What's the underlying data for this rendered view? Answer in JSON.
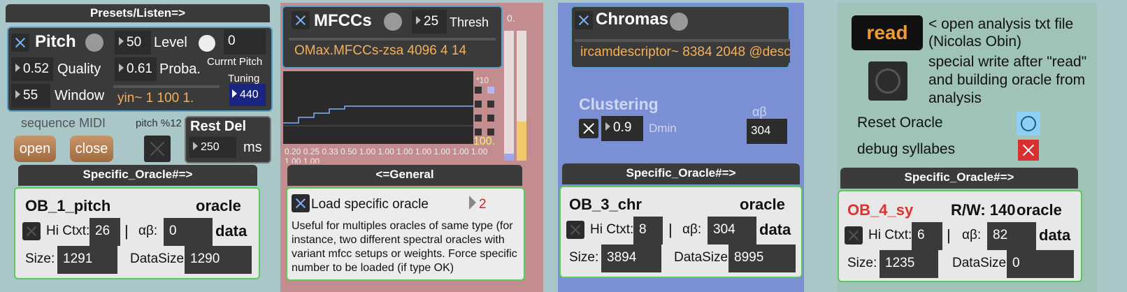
{
  "pitch_panel": {
    "header": "Presets/Listen=>",
    "title": "Pitch",
    "level_value": "50",
    "level_label": "Level",
    "level_number": "0",
    "quality_value": "0.52",
    "quality_label": "Quality",
    "proba_value": "0.61",
    "proba_label": "Proba.",
    "current_pitch_label": "Currnt Pitch",
    "tuning_label": "Tuning",
    "window_value": "55",
    "window_label": "Window",
    "yin_message": "yin~ 1 100 1.",
    "tuning_value": "440",
    "sequence_midi_label": "sequence MIDI",
    "pitch_mod_label": "pitch %12",
    "open_label": "open",
    "close_label": "close",
    "rest_del_label": "Rest Del",
    "rest_del_value": "250",
    "rest_del_unit": "ms",
    "specific_header": "Specific_Oracle#=>",
    "oracle": {
      "name": "OB_1_pitch",
      "oracle_label": "oracle",
      "hi_ctxt_label": "Hi Ctxt:",
      "hi_ctxt_value": "26",
      "ab_label": "αβ:",
      "ab_value": "0",
      "data_label": "data",
      "size_label": "Size:",
      "size_value": "1291",
      "datasize_label": "DataSize",
      "datasize_value": "1290"
    }
  },
  "mfcc_panel": {
    "title": "MFCCs",
    "thresh_value": "25",
    "thresh_label": "Thresh",
    "message": "OMax.MFCCs-zsa 4096 4 14",
    "scale_label_top": "*10",
    "meter_label": "0.",
    "meter_label_100": "100.",
    "axis_labels": "0.20 0.25 0.33 0.50 1.00 1.00 1.00 1.00 1.00 1.00 1.00 1.00 1.00",
    "general_header": "<=General",
    "load_label": "Load specific oracle",
    "load_number": "2",
    "description": "Useful for multiples oracles of same type (for instance, two different spectral oracles with variant mfcc setups or weights. Force specific number to be loaded (if type OK)"
  },
  "chroma_panel": {
    "title": "Chromas",
    "message": "ircamdescriptor~ 8384 2048 @desc",
    "clustering_label": "Clustering",
    "dmin_value": "0.9",
    "dmin_label": "Dmin",
    "ab_label": "αβ",
    "ab_value": "304",
    "specific_header": "Specific_Oracle#=>",
    "oracle": {
      "name": "OB_3_chr",
      "oracle_label": "oracle",
      "hi_ctxt_label": "Hi Ctxt:",
      "hi_ctxt_value": "8",
      "ab_label": "αβ:",
      "ab_value": "304",
      "data_label": "data",
      "size_label": "Size:",
      "size_value": "3894",
      "datasize_label": "DataSize",
      "datasize_value": "8995"
    }
  },
  "analysis_panel": {
    "read_label": "read",
    "read_desc": "< open analysis txt file (Nicolas Obin)",
    "special_desc": "special write after \"read\" and  building oracle from analysis",
    "reset_label": "Reset Oracle",
    "debug_label": "debug syllabes",
    "specific_header": "Specific_Oracle#=>",
    "oracle": {
      "name": "OB_4_sy",
      "rw_label": "R/W: 140",
      "oracle_label": "oracle",
      "hi_ctxt_label": "Hi Ctxt:",
      "hi_ctxt_value": "6",
      "ab_label": "αβ:",
      "ab_value": "82",
      "data_label": "data",
      "size_label": "Size:",
      "size_value": "1235",
      "datasize_label": "DataSize",
      "datasize_value": "0"
    }
  },
  "colors": {
    "pitch_bg": "#a9c6c8",
    "mfcc_bg": "#c38d8f",
    "chroma_bg": "#7b8fd4",
    "analysis_bg": "#9fc3b6",
    "oracle_border": "#5ac85a",
    "message_text": "#f3b05a",
    "read_text": "#f39a33"
  }
}
